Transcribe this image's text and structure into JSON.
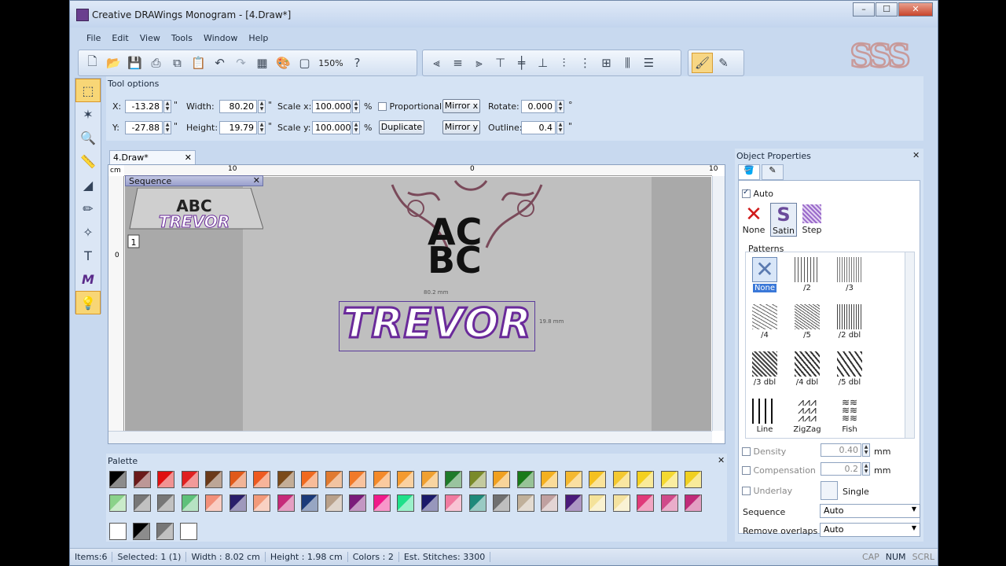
{
  "window": {
    "title": "Creative DRAWings Monogram - [4.Draw*]",
    "min": "–",
    "max": "☐",
    "close": "✕"
  },
  "menu": [
    "File",
    "Edit",
    "View",
    "Tools",
    "Window",
    "Help"
  ],
  "toolbar": {
    "zoom": "150%"
  },
  "logo_text": "SSS",
  "tool_options": {
    "title": "Tool options",
    "x_label": "X:",
    "x_value": "-13.28",
    "x_unit": "\"",
    "y_label": "Y:",
    "y_value": "-27.88",
    "y_unit": "\"",
    "width_label": "Width:",
    "width_value": "80.20",
    "width_unit": "\"",
    "height_label": "Height:",
    "height_value": "19.79",
    "height_unit": "\"",
    "scalex_label": "Scale x:",
    "scalex_value": "100.000",
    "scalex_unit": "%",
    "scaley_label": "Scale y:",
    "scaley_value": "100.000",
    "scaley_unit": "%",
    "proportional_label": "Proportional",
    "duplicate_label": "Duplicate",
    "mirrorx_label": "Mirror x",
    "mirrory_label": "Mirror y",
    "rotate_label": "Rotate:",
    "rotate_value": "0.000",
    "rotate_unit": "°",
    "outline_label": "Outline:",
    "outline_value": "0.4",
    "outline_unit": "\""
  },
  "document": {
    "tab": "4.Draw*",
    "ruler_unit": "cm",
    "ruler_top": [
      "10",
      "0",
      "10"
    ],
    "ruler_left": [
      "0"
    ],
    "sequence_title": "Sequence",
    "sequence_item_number": "1",
    "design_abc_top": "AC",
    "design_abc_bottom": "BC",
    "design_name": "TREVOR",
    "thumb_abc": "ABC",
    "thumb_name": "TREVOR",
    "dim_width": "80.2 mm",
    "dim_height": "19.8 mm"
  },
  "object_properties": {
    "title": "Object Properties",
    "auto_label": "Auto",
    "fill_types": [
      "None",
      "Satin",
      "Step"
    ],
    "patterns_label": "Patterns",
    "patterns": [
      "None",
      "/2",
      "/3",
      "/4",
      "/5",
      "/2 dbl",
      "/3 dbl",
      "/4 dbl",
      "/5 dbl",
      "Line",
      "ZigZag",
      "Fish"
    ],
    "density_label": "Density",
    "density_value": "0.40",
    "density_unit": "mm",
    "compensation_label": "Compensation",
    "compensation_value": "0.2",
    "compensation_unit": "mm",
    "underlay_label": "Underlay",
    "underlay_value": "Single",
    "sequence_label": "Sequence",
    "sequence_value": "Auto",
    "remove_overlaps_label": "Remove overlaps",
    "remove_overlaps_value": "Auto"
  },
  "palette": {
    "title": "Palette",
    "row1": [
      "#000000",
      "#6b1a1a",
      "#e01010",
      "#e02020",
      "#6b3a1a",
      "#e05a1a",
      "#ee5a20",
      "#7a4a1a",
      "#f06a20",
      "#e07a30",
      "#f07a2a",
      "#f48a2a",
      "#f49a30",
      "#f0a030",
      "#1e7a2a",
      "#7a8a2a",
      "#f0a020",
      "#1a7a1a",
      "#f4b020",
      "#f4b830",
      "#f4c020",
      "#f4c830",
      "#f4d020",
      "#f4d830",
      "#f0d020"
    ],
    "row2": [
      "#8ad28a",
      "#777777",
      "#777777",
      "#5ec17a",
      "#f2907a",
      "#2a1e6a",
      "#f29a7a",
      "#c62a7a",
      "#1a3a7a",
      "#b8a08a",
      "#7a1a7a",
      "#f01a8a",
      "#20e08a",
      "#1a1a6a",
      "#f07aa0",
      "#1e8a7a",
      "#707070",
      "#c0b09a",
      "#c0a0a0",
      "#4a1a7a",
      "#f4e29a",
      "#f4e2a0",
      "#e03a7a",
      "#d04a8a",
      "#c02a7a"
    ],
    "tools": [
      "none-color",
      "black-color",
      "gray-color",
      "picker"
    ]
  },
  "status": {
    "items": "Items:6",
    "selected": "Selected: 1 (1)",
    "width": "Width : 8.02 cm",
    "height": "Height : 1.98 cm",
    "colors": "Colors : 2",
    "stitches": "Est. Stitches: 3300",
    "cap": "CAP",
    "num": "NUM",
    "scrl": "SCRL"
  }
}
